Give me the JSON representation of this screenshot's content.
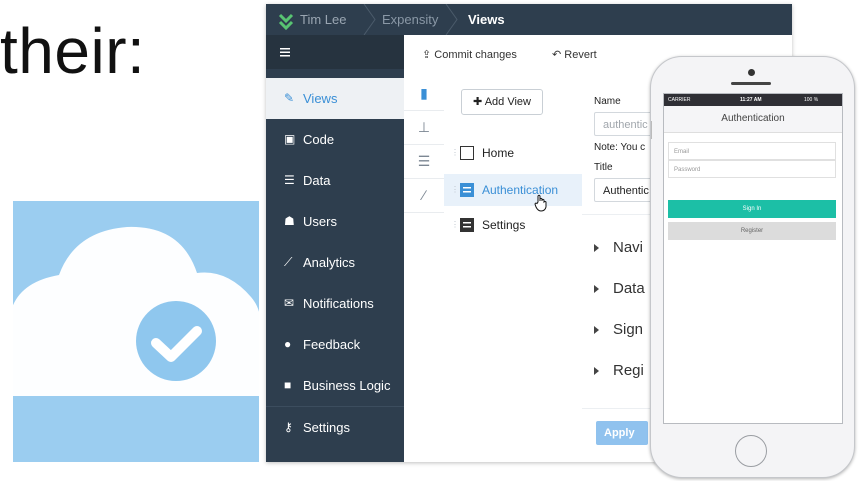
{
  "slide": {
    "title_fragment": "their:"
  },
  "app": {
    "breadcrumb": [
      "Tim Lee",
      "Expensity",
      "Views"
    ],
    "toolbar": {
      "commit_label": "Commit changes",
      "revert_label": "Revert"
    },
    "sidebar": {
      "items": [
        {
          "label": "Views",
          "icon": "pencil-square-icon"
        },
        {
          "label": "Code",
          "icon": "code-file-icon"
        },
        {
          "label": "Data",
          "icon": "database-icon"
        },
        {
          "label": "Users",
          "icon": "users-icon"
        },
        {
          "label": "Analytics",
          "icon": "line-chart-icon"
        },
        {
          "label": "Notifications",
          "icon": "envelope-icon"
        },
        {
          "label": "Feedback",
          "icon": "comment-icon"
        },
        {
          "label": "Business Logic",
          "icon": "briefcase-icon"
        },
        {
          "label": "Settings",
          "icon": "key-icon"
        }
      ]
    },
    "views_panel": {
      "add_view_label": "Add View",
      "views": [
        {
          "label": "Home"
        },
        {
          "label": "Authentication"
        },
        {
          "label": "Settings"
        }
      ]
    },
    "properties": {
      "name_label": "Name",
      "name_value": "authentic",
      "note": "Note: You c",
      "title_label": "Title",
      "title_value": "Authentic",
      "sections": [
        "Navi",
        "Data",
        "Sign",
        "Regi"
      ],
      "apply_label": "Apply"
    }
  },
  "phone": {
    "status": {
      "carrier": "CARRIER",
      "time": "11:27 AM",
      "battery": "100 %"
    },
    "nav_title": "Authentication",
    "email_placeholder": "Email",
    "password_placeholder": "Password",
    "sign_in_label": "Sign In",
    "register_label": "Register"
  },
  "colors": {
    "sidebar_bg": "#2e3e4e",
    "accent": "#3a8fd6",
    "sign_in": "#1cbfa6",
    "cloud_tile": "#9bcdf0"
  }
}
